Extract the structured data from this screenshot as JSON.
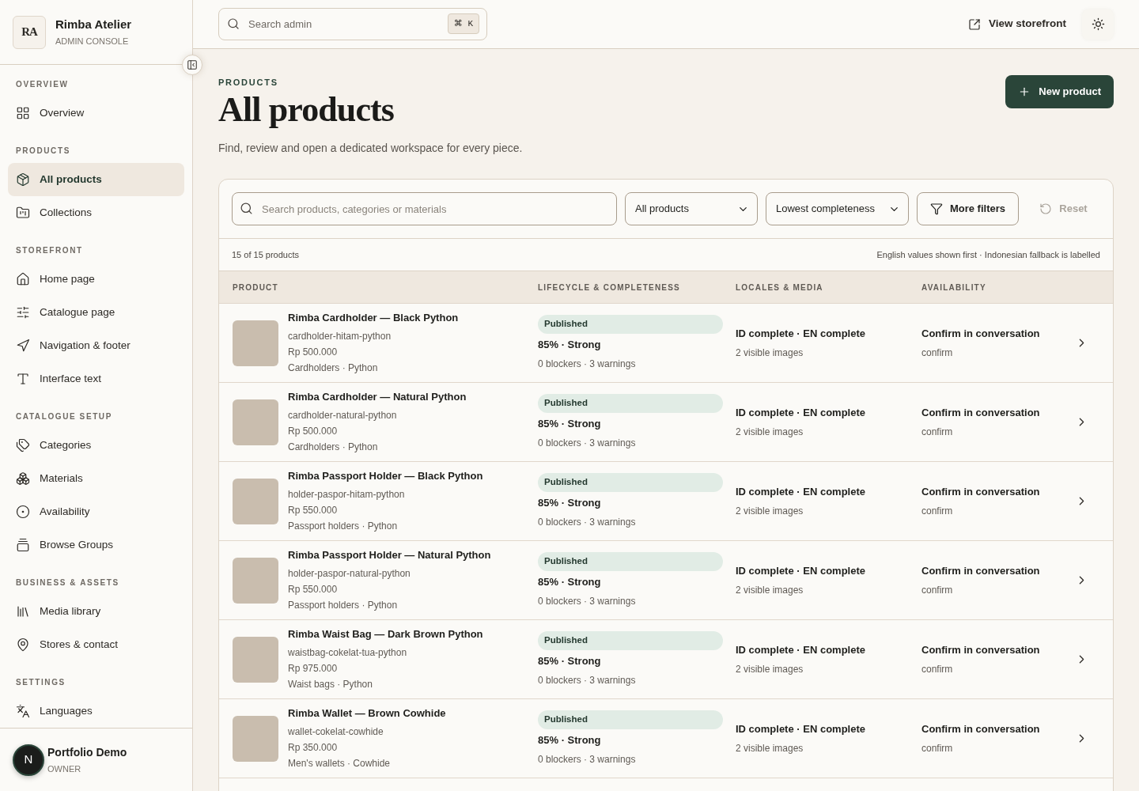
{
  "sidebar": {
    "brand": {
      "monogram": "RA",
      "title": "Rimba Atelier",
      "subtitle": "ADMIN CONSOLE"
    },
    "sections": [
      {
        "heading": "OVERVIEW",
        "items": [
          {
            "label": "Overview",
            "selected": false
          }
        ]
      },
      {
        "heading": "PRODUCTS",
        "items": [
          {
            "label": "All products",
            "selected": true
          },
          {
            "label": "Collections",
            "selected": false
          }
        ]
      },
      {
        "heading": "STOREFRONT",
        "items": [
          {
            "label": "Home page",
            "selected": false
          },
          {
            "label": "Catalogue page",
            "selected": false
          },
          {
            "label": "Navigation & footer",
            "selected": false
          },
          {
            "label": "Interface text",
            "selected": false
          }
        ]
      },
      {
        "heading": "CATALOGUE SETUP",
        "items": [
          {
            "label": "Categories",
            "selected": false
          },
          {
            "label": "Materials",
            "selected": false
          },
          {
            "label": "Availability",
            "selected": false
          },
          {
            "label": "Browse Groups",
            "selected": false
          }
        ]
      },
      {
        "heading": "BUSINESS & ASSETS",
        "items": [
          {
            "label": "Media library",
            "selected": false
          },
          {
            "label": "Stores & contact",
            "selected": false
          }
        ]
      },
      {
        "heading": "SETTINGS",
        "items": [
          {
            "label": "Languages",
            "selected": false
          }
        ]
      }
    ],
    "user": {
      "initial": "N",
      "name": "Portfolio Demo",
      "role": "OWNER"
    }
  },
  "topbar": {
    "search": {
      "placeholder": "Search admin",
      "shortcut": "⌘ K"
    },
    "storefront_link": "View storefront"
  },
  "header": {
    "eyebrow": "PRODUCTS",
    "title": "All products",
    "subtitle": "Find, review and open a dedicated workspace for every piece.",
    "new_button": "New product"
  },
  "filters": {
    "search": {
      "placeholder": "Search products, categories or materials"
    },
    "selects": [
      {
        "value": "All products"
      },
      {
        "value": "Lowest completeness"
      }
    ],
    "more_button": "More filters",
    "reset": {
      "label": "Reset",
      "disabled": true
    }
  },
  "summary": {
    "count": "15 of 15 products",
    "note": "English values shown first · Indonesian fallback is labelled"
  },
  "table": {
    "columns": [
      "PRODUCT",
      "LIFECYCLE & COMPLETENESS",
      "LOCALES & MEDIA",
      "AVAILABILITY"
    ],
    "rows": [
      {
        "name": "Rimba Cardholder — Black Python",
        "slug": "cardholder-hitam-python",
        "price": "Rp 500.000",
        "category": "Cardholders · Python",
        "status": "Published",
        "score": "85% · Strong",
        "issues": "0 blockers · 3 warnings",
        "locales": "ID complete · EN complete",
        "media": "2 visible images",
        "availability": "Confirm in conversation",
        "availability_note": "confirm"
      },
      {
        "name": "Rimba Cardholder — Natural Python",
        "slug": "cardholder-natural-python",
        "price": "Rp 500.000",
        "category": "Cardholders · Python",
        "status": "Published",
        "score": "85% · Strong",
        "issues": "0 blockers · 3 warnings",
        "locales": "ID complete · EN complete",
        "media": "2 visible images",
        "availability": "Confirm in conversation",
        "availability_note": "confirm"
      },
      {
        "name": "Rimba Passport Holder — Black Python",
        "slug": "holder-paspor-hitam-python",
        "price": "Rp 550.000",
        "category": "Passport holders · Python",
        "status": "Published",
        "score": "85% · Strong",
        "issues": "0 blockers · 3 warnings",
        "locales": "ID complete · EN complete",
        "media": "2 visible images",
        "availability": "Confirm in conversation",
        "availability_note": "confirm"
      },
      {
        "name": "Rimba Passport Holder — Natural Python",
        "slug": "holder-paspor-natural-python",
        "price": "Rp 550.000",
        "category": "Passport holders · Python",
        "status": "Published",
        "score": "85% · Strong",
        "issues": "0 blockers · 3 warnings",
        "locales": "ID complete · EN complete",
        "media": "2 visible images",
        "availability": "Confirm in conversation",
        "availability_note": "confirm"
      },
      {
        "name": "Rimba Waist Bag — Dark Brown Python",
        "slug": "waistbag-cokelat-tua-python",
        "price": "Rp 975.000",
        "category": "Waist bags · Python",
        "status": "Published",
        "score": "85% · Strong",
        "issues": "0 blockers · 3 warnings",
        "locales": "ID complete · EN complete",
        "media": "2 visible images",
        "availability": "Confirm in conversation",
        "availability_note": "confirm"
      },
      {
        "name": "Rimba Wallet — Brown Cowhide",
        "slug": "wallet-cokelat-cowhide",
        "price": "Rp 350.000",
        "category": "Men's wallets · Cowhide",
        "status": "Published",
        "score": "85% · Strong",
        "issues": "0 blockers · 3 warnings",
        "locales": "ID complete · EN complete",
        "media": "2 visible images",
        "availability": "Confirm in conversation",
        "availability_note": "confirm"
      }
    ]
  }
}
